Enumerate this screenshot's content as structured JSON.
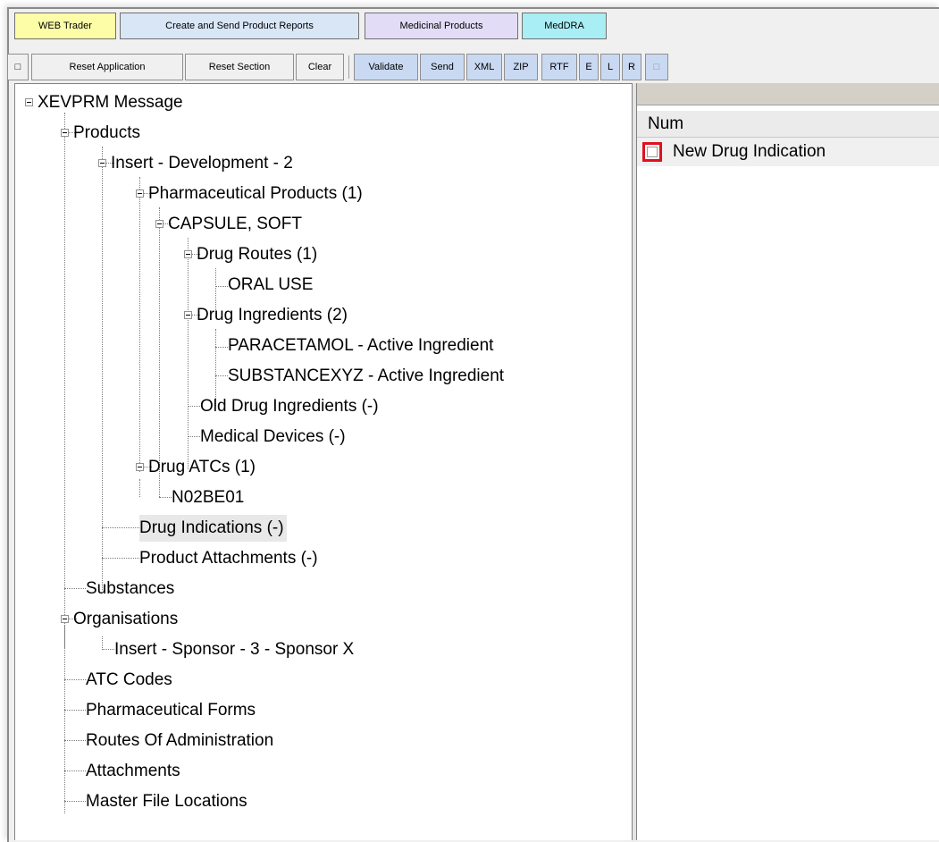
{
  "tabs": {
    "web_trader": "WEB Trader",
    "create_send": "Create and Send Product Reports",
    "medicinal_products": "Medicinal Products",
    "meddra": "MedDRA"
  },
  "toolbar": {
    "collapse_glyph": "□",
    "reset_application": "Reset Application",
    "reset_section": "Reset Section",
    "clear": "Clear",
    "validate": "Validate",
    "send": "Send",
    "xml": "XML",
    "zip": "ZIP",
    "rtf": "RTF",
    "e": "E",
    "l": "L",
    "r": "R",
    "extra_glyph": "□"
  },
  "tree": {
    "root": "XEVPRM Message",
    "products": "Products",
    "insert_dev": "Insert - Development - 2",
    "pharm_products": "Pharmaceutical Products (1)",
    "capsule": "CAPSULE, SOFT",
    "drug_routes": "Drug Routes (1)",
    "oral_use": "ORAL USE",
    "drug_ingredients": "Drug Ingredients (2)",
    "paracetamol": "PARACETAMOL - Active Ingredient",
    "substancexyz": "SUBSTANCEXYZ - Active Ingredient",
    "old_drug_ingredients": "Old Drug Ingredients (-)",
    "medical_devices": "Medical Devices (-)",
    "drug_atcs": "Drug ATCs (1)",
    "n02be01": "N02BE01",
    "drug_indications": "Drug Indications (-)",
    "product_attachments": "Product Attachments (-)",
    "substances": "Substances",
    "organisations": "Organisations",
    "insert_sponsor": "Insert - Sponsor - 3 - Sponsor X",
    "atc_codes": "ATC Codes",
    "pharm_forms": "Pharmaceutical Forms",
    "routes_admin": "Routes Of Administration",
    "attachments": "Attachments",
    "master_file_locations": "Master File Locations"
  },
  "list": {
    "column_num": "Num",
    "row_label": "New Drug Indication"
  },
  "colors": {
    "tab_web_trader": "#fdfda8",
    "tab_create_send": "#d8e6f6",
    "tab_medicinal": "#e2dcf6",
    "tab_meddra": "#a8eef4",
    "selected_node_bg": "#e8e8e8",
    "highlight_red": "#e01020"
  }
}
